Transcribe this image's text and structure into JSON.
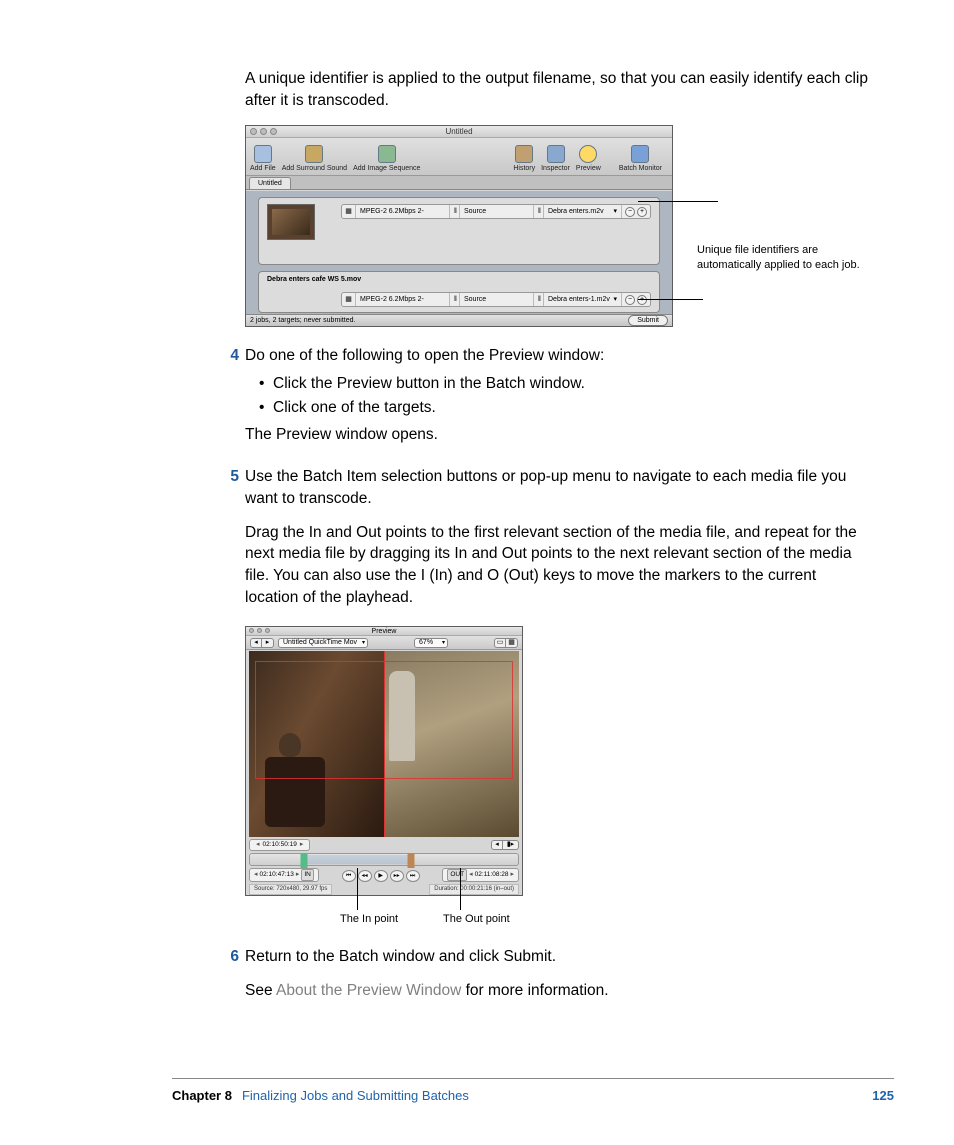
{
  "intro_para": "A unique identifier is applied to the output filename, so that you can easily identify each clip after it is transcoded.",
  "figure1": {
    "window_title": "Untitled",
    "toolbar": {
      "add_file": "Add File",
      "add_surround": "Add Surround Sound",
      "add_image_seq": "Add Image Sequence",
      "history": "History",
      "inspector": "Inspector",
      "preview": "Preview",
      "batch_monitor": "Batch Monitor"
    },
    "tab": "Untitled",
    "jobs": [
      {
        "title": "",
        "setting": "MPEG-2 6.2Mbps 2-",
        "source": "Source",
        "output": "Debra enters.m2v"
      },
      {
        "title": "Debra enters cafe WS 5.mov",
        "setting": "MPEG-2 6.2Mbps 2-",
        "source": "Source",
        "output": "Debra enters-1.m2v"
      }
    ],
    "status": "2 jobs, 2 targets; never submitted.",
    "submit": "Submit",
    "callout": "Unique file identifiers are automatically applied to each job."
  },
  "step4": {
    "num": "4",
    "lead": "Do one of the following to open the Preview window:",
    "bullets": [
      "Click the Preview button in the Batch window.",
      "Click one of the targets."
    ],
    "after": "The Preview window opens."
  },
  "step5": {
    "num": "5",
    "lead": "Use the Batch Item selection buttons or pop-up menu to navigate to each media file you want to transcode.",
    "para2": "Drag the In and Out points to the first relevant section of the media file, and repeat for the next media file by dragging its In and Out points to the next relevant section of the media file. You can also use the I (In) and O (Out) keys to move the markers to the current location of the playhead."
  },
  "figure2": {
    "window_title": "Preview",
    "clip_popup": "Untitled QuickTime Mov",
    "zoom": "67%",
    "tc_top": "02:10:50:19",
    "tc_in": "02:10:47:13",
    "tc_out": "02:11:08:28",
    "in_label": "IN",
    "out_label": "OUT",
    "source_info": "Source: 720x480, 29.97 fps",
    "duration_info": "Duration: 00:00:21:16 (in–out)",
    "callout_in": "The In point",
    "callout_out": "The Out point"
  },
  "step6": {
    "num": "6",
    "text": "Return to the Batch window and click Submit."
  },
  "see_more_pre": "See ",
  "see_more_link": "About the Preview Window",
  "see_more_post": " for more information.",
  "footer": {
    "chapter": "Chapter 8",
    "title": "Finalizing Jobs and Submitting Batches",
    "page": "125"
  }
}
